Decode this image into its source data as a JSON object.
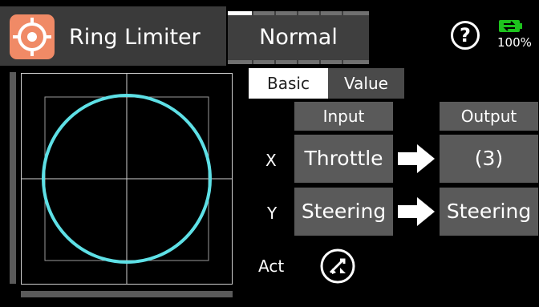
{
  "header": {
    "title": "Ring Limiter",
    "mode": "Normal",
    "battery_percent": "100%"
  },
  "tabs": [
    {
      "label": "Basic",
      "active": true
    },
    {
      "label": "Value",
      "active": false
    }
  ],
  "columns": {
    "input": "Input",
    "output": "Output"
  },
  "rows": [
    {
      "label": "X",
      "input": "Throttle",
      "output": "(3)"
    },
    {
      "label": "Y",
      "input": "Steering",
      "output": "Steering"
    }
  ],
  "act": {
    "label": "Act"
  },
  "colors": {
    "accent_icon": "#f08a66",
    "ring": "#5ee0e6",
    "battery": "#1dc41d",
    "cell_bg": "#5a5a5a"
  }
}
